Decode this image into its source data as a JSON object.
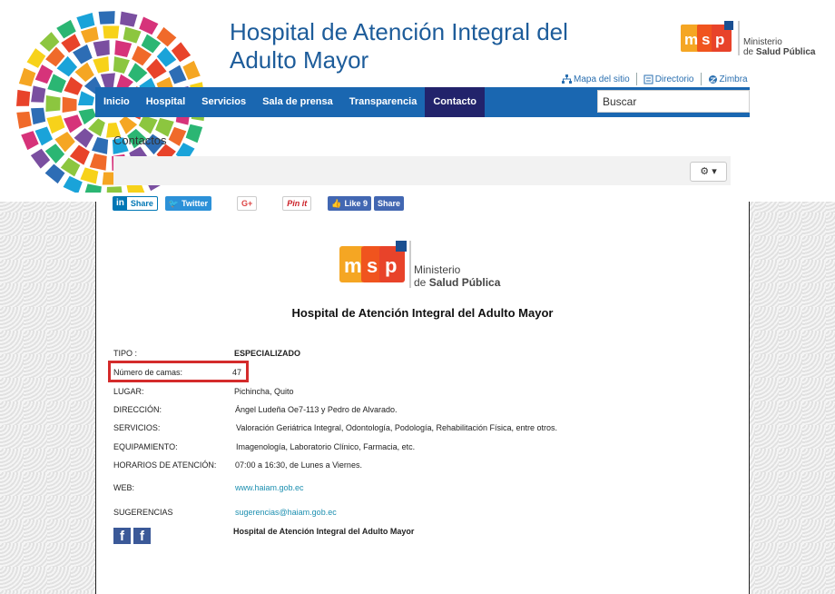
{
  "header": {
    "title_line1": "Hospital de Atención Integral del",
    "title_line2": "Adulto Mayor",
    "ministry_line1": "Ministerio",
    "ministry_prefix": "de ",
    "ministry_bold": "Salud Pública"
  },
  "util_links": [
    "Mapa del sitio",
    "Directorio",
    "Zimbra"
  ],
  "nav": {
    "items": [
      "Inicio",
      "Hospital",
      "Servicios",
      "Sala de prensa",
      "Transparencia",
      "Contacto"
    ],
    "active": "Contacto"
  },
  "search": {
    "placeholder": "Buscar"
  },
  "page": {
    "heading": "Contactos"
  },
  "share": {
    "linkedin": "Share",
    "twitter": "Twitter",
    "google": "G+",
    "pinterest": "Pin it",
    "like": "Like 9",
    "fb_share": "Share"
  },
  "main": {
    "title": "Hospital de Atención Integral del Adulto Mayor",
    "info": [
      {
        "label": "TIPO :",
        "value": "ESPECIALIZADO"
      },
      {
        "label": "Número de camas:",
        "value": "47"
      },
      {
        "label": "LUGAR:",
        "value": "Pichincha, Quito"
      },
      {
        "label": "DIRECCIÓN:",
        "value": "Ángel Ludeña Oe7-113 y Pedro de Alvarado."
      },
      {
        "label": "SERVICIOS:",
        "value": "Valoración Geriátrica Integral, Odontología, Podología, Rehabilitación Física, entre otros."
      },
      {
        "label": "EQUIPAMIENTO:",
        "value": "Imagenología, Laboratorio Clínico, Farmacia, etc."
      },
      {
        "label": "HORARIOS DE ATENCIÓN:",
        "value": "07:00 a 16:30, de Lunes a Viernes."
      },
      {
        "label": "WEB:",
        "value": "www.haiam.gob.ec"
      },
      {
        "label": "SUGERENCIAS",
        "value": "sugerencias@haiam.gob.ec"
      }
    ],
    "footer_name": "Hospital de Atención Integral del Adulto Mayor"
  },
  "colors": {
    "nav_bg": "#1a67b1",
    "nav_active": "#22236b",
    "title_blue": "#1d5c9a",
    "highlight": "#d42b2b",
    "link": "#1c8fb0",
    "msp_orange": "#f5a623",
    "msp_red": "#e8432a",
    "msp_blue": "#1a4f91"
  }
}
